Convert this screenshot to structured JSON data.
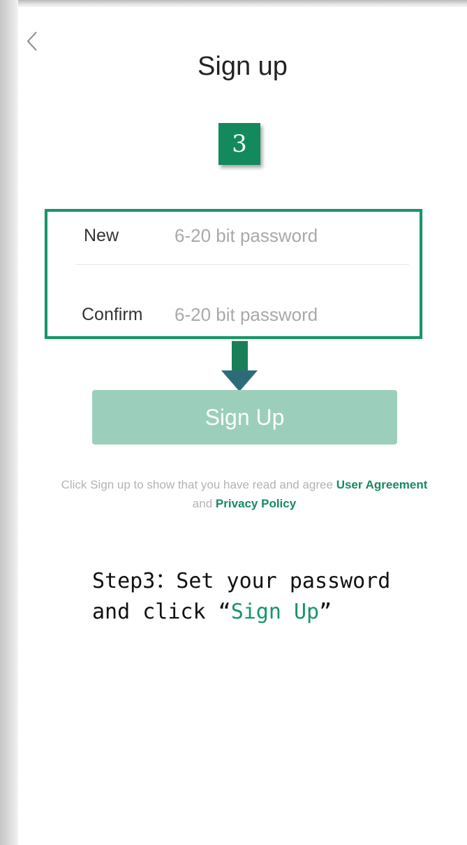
{
  "header": {
    "title": "Sign up",
    "back_icon": "chevron-left-icon"
  },
  "annotation": {
    "step_number": "3",
    "highlight_color": "#17956a",
    "arrow_color": "#1a7f58",
    "caption_line1": "Step3：Set your password",
    "caption_line2_prefix": "and click",
    "caption_open_quote": "“",
    "caption_highlight": "Sign Up",
    "caption_close_quote": "”"
  },
  "form": {
    "new_label": "New",
    "new_placeholder": "6-20 bit password",
    "new_value": "",
    "confirm_label": "Confirm",
    "confirm_placeholder": "6-20 bit password",
    "confirm_value": ""
  },
  "actions": {
    "signup_label": "Sign Up",
    "signup_color": "#9ccfbb"
  },
  "agreement": {
    "text_before": "Click Sign up to show that you have read and agree",
    "user_agreement_link": "User Agreement",
    "and_text": "and",
    "privacy_policy_link": "Privacy Policy",
    "link_color": "#178a5f"
  }
}
